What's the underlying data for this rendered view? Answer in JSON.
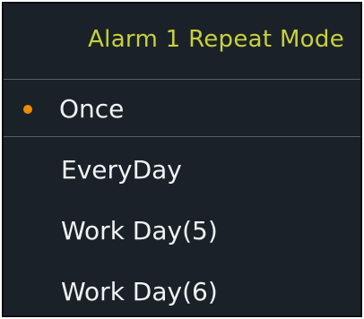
{
  "menu": {
    "title": "Alarm 1 Repeat Mode",
    "options": [
      {
        "label": "Once",
        "selected": true
      },
      {
        "label": "EveryDay",
        "selected": false
      },
      {
        "label": "Work Day(5)",
        "selected": false
      },
      {
        "label": "Work Day(6)",
        "selected": false
      }
    ]
  },
  "colors": {
    "background": "#1b2128",
    "title": "#c7d23a",
    "text": "#f0f3f4",
    "bullet": "#f08c00",
    "divider": "#5f6a73"
  }
}
